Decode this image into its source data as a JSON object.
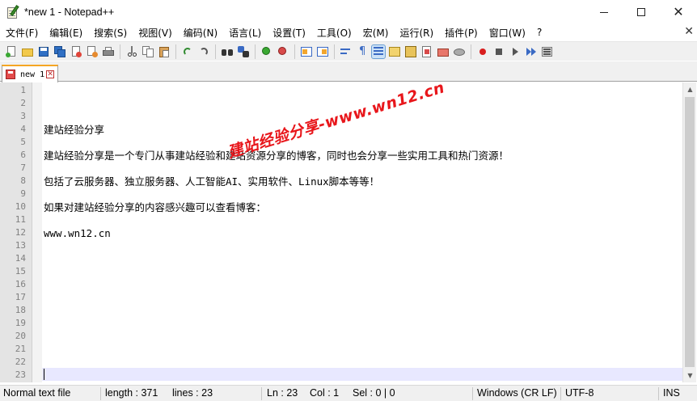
{
  "window": {
    "title": "*new 1 - Notepad++",
    "minimize": "",
    "maximize": "",
    "close": "✕"
  },
  "menu": {
    "items": [
      "文件(F)",
      "编辑(E)",
      "搜索(S)",
      "视图(V)",
      "编码(N)",
      "语言(L)",
      "设置(T)",
      "工具(O)",
      "宏(M)",
      "运行(R)",
      "插件(P)",
      "窗口(W)",
      "?"
    ],
    "close_label": "✕"
  },
  "toolbar": {
    "icons": [
      "new-file-icon",
      "open-file-icon",
      "save-icon",
      "save-all-icon",
      "close-icon",
      "close-all-icon",
      "print-icon",
      "cut-icon",
      "copy-icon",
      "paste-icon",
      "undo-icon",
      "redo-icon",
      "find-icon",
      "replace-icon",
      "zoom-in-icon",
      "zoom-out-icon",
      "sync-vertical-icon",
      "sync-horizontal-icon",
      "word-wrap-icon",
      "show-all-chars-icon",
      "indent-guide-icon",
      "doc-map-icon",
      "function-list-icon",
      "folder-workspace-icon",
      "monitoring-icon",
      "record-macro-icon",
      "stop-record-icon",
      "play-macro-icon",
      "run-macro-multiple-icon",
      "save-macro-icon"
    ]
  },
  "tab": {
    "label": "new 1",
    "close": "✕"
  },
  "editor": {
    "line_numbers": [
      "1",
      "2",
      "3",
      "4",
      "5",
      "6",
      "7",
      "8",
      "9",
      "10",
      "11",
      "12",
      "13",
      "14",
      "15",
      "16",
      "17",
      "18",
      "19",
      "20",
      "21",
      "22",
      "23"
    ],
    "lines": [
      "",
      "",
      "",
      "建站经验分享",
      "",
      "建站经验分享是一个专门从事建站经验和建站资源分享的博客，同时也会分享一些实用工具和热门资源！",
      "",
      "包括了云服务器、独立服务器、人工智能AI、实用软件、Linux脚本等等！",
      "",
      "如果对建站经验分享的内容感兴趣可以查看博客：",
      "",
      "www.wn12.cn",
      "",
      "",
      "",
      "",
      "",
      "",
      "",
      "",
      "",
      "",
      ""
    ],
    "watermark": "建站经验分享-www.wn12.cn"
  },
  "status": {
    "file_type": "Normal text file",
    "length": "length : 371",
    "lines": "lines : 23",
    "ln": "Ln : 23",
    "col": "Col : 1",
    "sel": "Sel : 0 | 0",
    "eol": "Windows (CR LF)",
    "encoding": "UTF-8",
    "mode": "INS"
  },
  "colors": {
    "tab_accent": "#f5a623",
    "watermark": "#e8161b",
    "current_line": "#e8e8ff",
    "gutter": "#e4e4e4"
  }
}
